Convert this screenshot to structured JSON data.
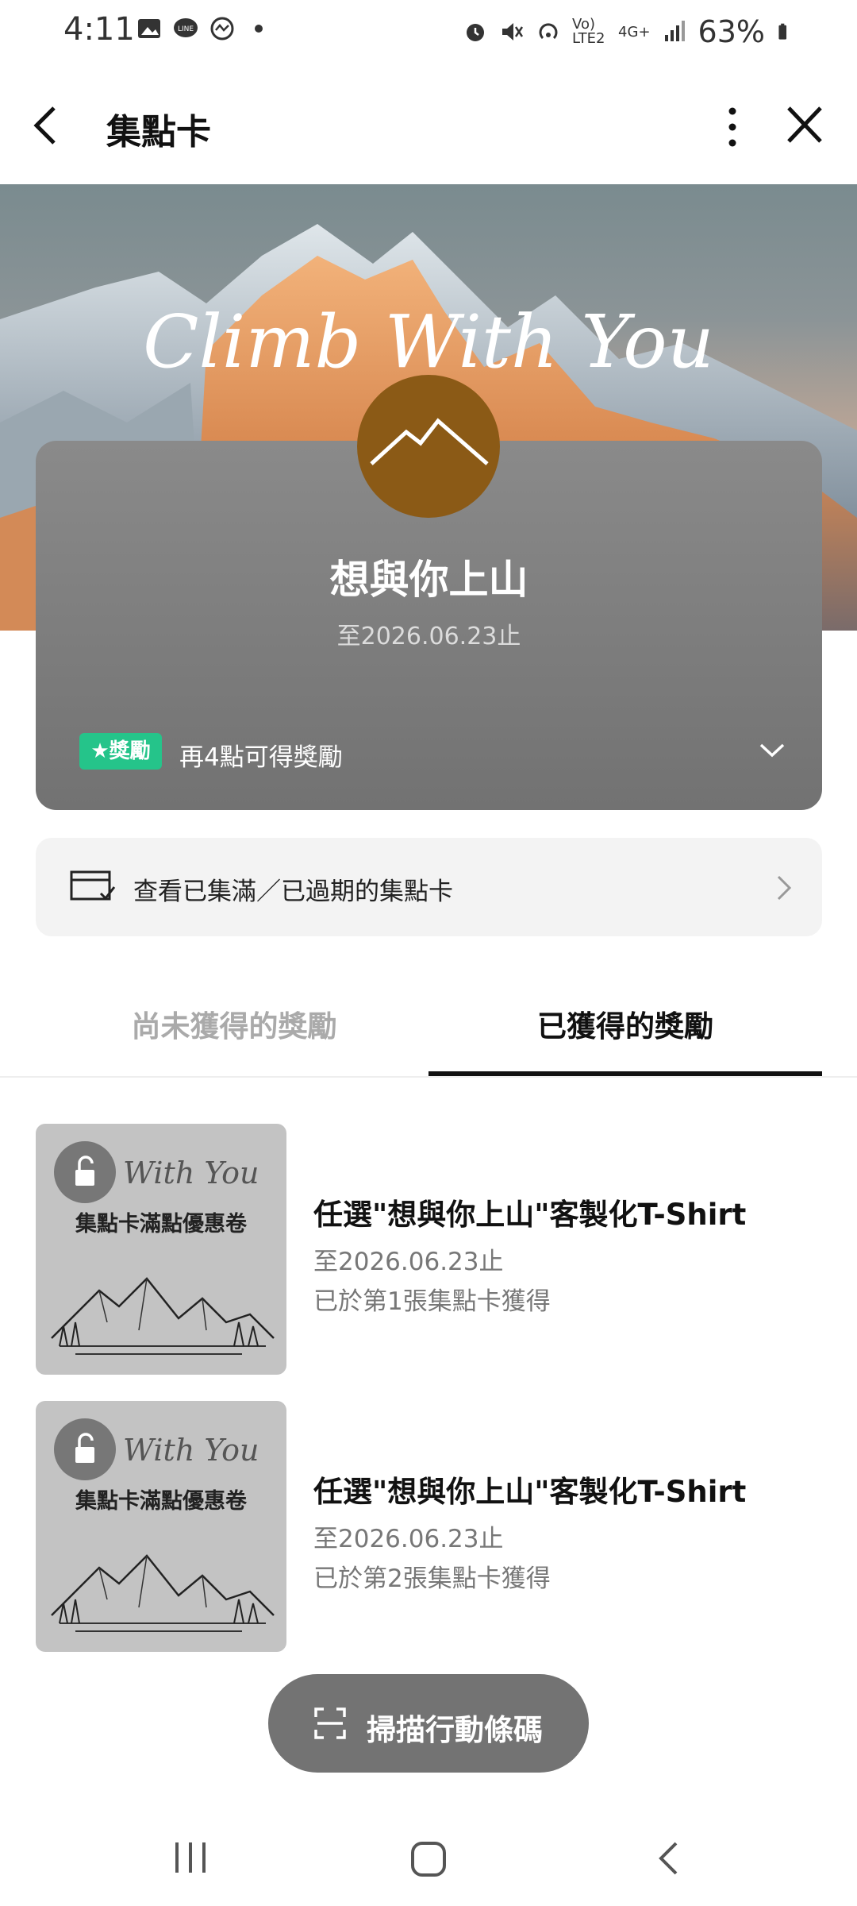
{
  "status_bar": {
    "time": "4:11",
    "network": "Vo) LTE2",
    "network_type": "4G+",
    "battery": "63%",
    "left_icons": [
      "gallery-icon",
      "line-icon",
      "activity-icon",
      "dot-icon"
    ],
    "right_icons": [
      "alarm-icon",
      "mute-icon",
      "hotspot-icon",
      "signal-icon",
      "battery-icon"
    ]
  },
  "header": {
    "title": "集點卡",
    "back_icon": "chevron-left-icon",
    "more_icon": "more-vertical-icon",
    "close_icon": "close-icon"
  },
  "banner": {
    "script_text": "Climb With You"
  },
  "card": {
    "name": "想與你上山",
    "valid_until": "至2026.06.23止",
    "reward_badge": "★獎勵",
    "reward_text": "再4點可得獎勵",
    "accent": "#25c48a"
  },
  "history": {
    "label": "查看已集滿／已過期的集點卡"
  },
  "tabs": {
    "unearned": "尚未獲得的獎勵",
    "earned": "已獲得的獎勵"
  },
  "rewards": [
    {
      "thumb_script": "With You",
      "thumb_label": "集點卡滿點優惠卷",
      "title": "任選\"想與你上山\"客製化T-Shirt",
      "date": "至2026.06.23止",
      "note": "已於第1張集點卡獲得"
    },
    {
      "thumb_script": "With You",
      "thumb_label": "集點卡滿點優惠卷",
      "title": "任選\"想與你上山\"客製化T-Shirt",
      "date": "至2026.06.23止",
      "note": "已於第2張集點卡獲得"
    }
  ],
  "scan_button": {
    "label": "掃描行動條碼"
  },
  "nav": {
    "recents_icon": "recents-icon",
    "home_icon": "home-icon",
    "back_icon": "back-icon"
  }
}
